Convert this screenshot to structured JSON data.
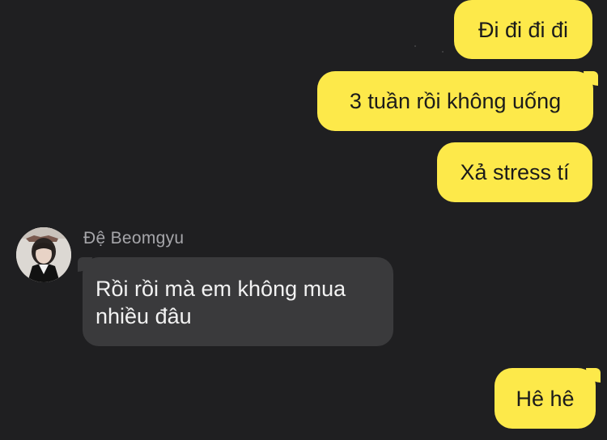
{
  "conversation": {
    "outgoing": [
      {
        "text": "Đi đi đi đi"
      },
      {
        "text": "3 tuần rồi không uống"
      },
      {
        "text": "Xả stress tí"
      },
      {
        "text": "Hê hê"
      }
    ],
    "incoming": {
      "sender": "Đệ Beomgyu",
      "text": "Rồi rồi mà em không mua nhiều đâu"
    }
  },
  "colors": {
    "background": "#1f1f21",
    "outgoing_bubble": "#fde94a",
    "incoming_bubble": "#3a3a3c"
  }
}
